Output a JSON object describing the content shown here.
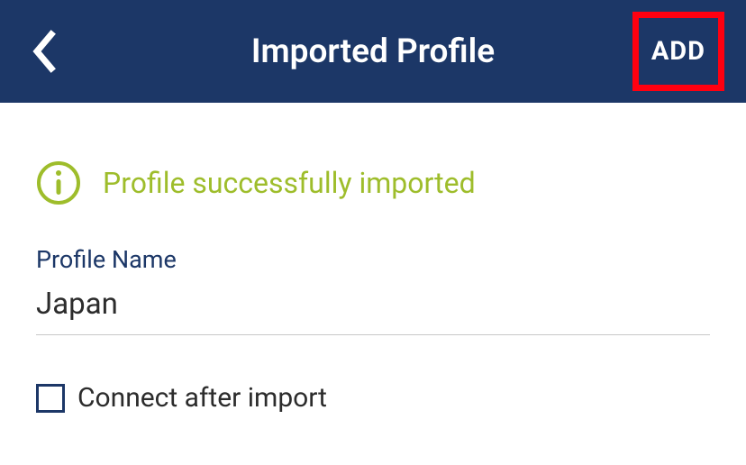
{
  "header": {
    "title": "Imported Profile",
    "add_label": "ADD"
  },
  "status": {
    "message": "Profile successfully imported",
    "color": "#9ebd2b"
  },
  "profile": {
    "label": "Profile Name",
    "value": "Japan"
  },
  "connect": {
    "label": "Connect after import",
    "checked": false
  },
  "colors": {
    "header_bg": "#1c3767",
    "highlight": "#ff0010",
    "accent": "#9ebd2b"
  }
}
